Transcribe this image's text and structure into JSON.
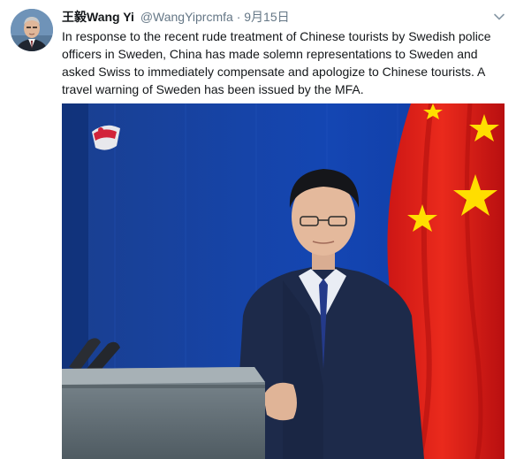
{
  "tweet": {
    "display_name": "王毅Wang Yi",
    "handle": "@WangYiprcmfa",
    "separator": "·",
    "date": "9月15日",
    "text": "In response to the recent rude treatment of Chinese tourists by Swedish police officers in Sweden, China has made solemn representations to Sweden and asked Swiss to immediately compensate and apologize to Chinese tourists. A travel warning of Sweden has been issued by the MFA.",
    "avatar_icon": "user-avatar",
    "menu_icon": "chevron-down-icon",
    "media": {
      "type": "photo",
      "subject": "spokesperson-at-podium",
      "background_color": "#133c92",
      "flag_color": "#de2910",
      "star_color": "#ffde00"
    }
  }
}
